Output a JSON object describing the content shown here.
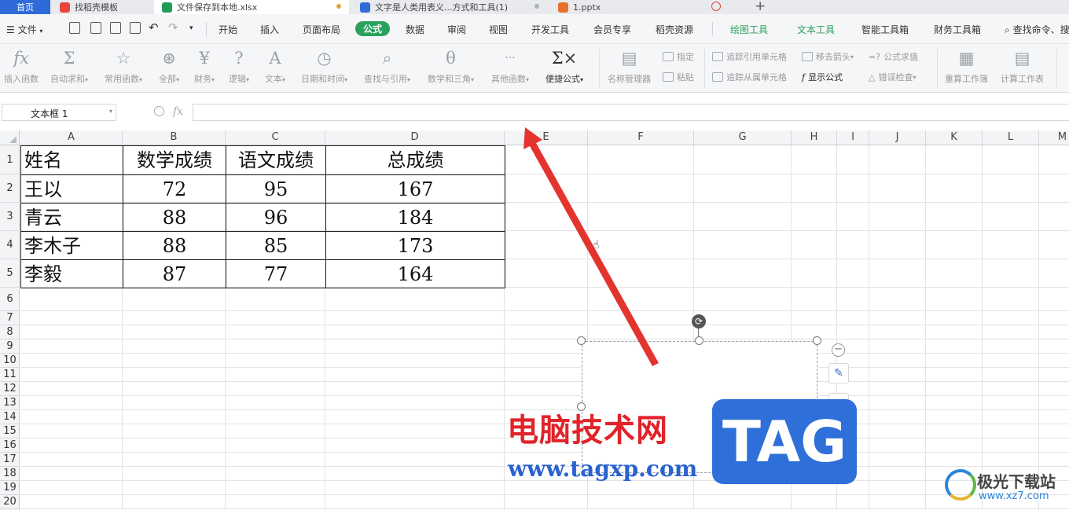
{
  "tabs": [
    {
      "label": "首页",
      "kind": "home"
    },
    {
      "label": "找稻壳模板",
      "kind": "docer",
      "color": "#e8453c"
    },
    {
      "label": "文件保存到本地.xlsx",
      "kind": "sheet",
      "color": "#1f9d55",
      "active": true,
      "dot_color": "#e6a23c"
    },
    {
      "label": "文字是人类用表义...方式和工具(1)",
      "kind": "word",
      "color": "#2f6bd8",
      "dot_color": "#b0b3b8"
    },
    {
      "label": "1.pptx",
      "kind": "ppt",
      "color": "#e6712b",
      "dot_color": "#e04b3a"
    }
  ],
  "menu": {
    "file": "文件",
    "items": [
      "开始",
      "插入",
      "页面布局",
      "公式",
      "数据",
      "审阅",
      "视图",
      "开发工具",
      "会员专享",
      "稻壳资源"
    ],
    "active": "公式",
    "green_items": [
      "绘图工具",
      "文本工具"
    ],
    "right_items": [
      "智能工具箱",
      "财务工具箱"
    ],
    "search": "查找命令、搜"
  },
  "ribbon": {
    "buttons": [
      {
        "label": "插入函数",
        "icon": "fx-icon",
        "glyph": "fx"
      },
      {
        "label": "自动求和",
        "icon": "sigma-icon",
        "glyph": "Σ",
        "caret": true
      },
      {
        "label": "常用函数",
        "icon": "star-icon",
        "glyph": "☆",
        "caret": true
      },
      {
        "label": "全部",
        "icon": "asterisk-icon",
        "glyph": "⊛",
        "caret": true
      },
      {
        "label": "财务",
        "icon": "yen-icon",
        "glyph": "¥",
        "caret": true
      },
      {
        "label": "逻辑",
        "icon": "question-icon",
        "glyph": "?",
        "caret": true
      },
      {
        "label": "文本",
        "icon": "text-a-icon",
        "glyph": "A",
        "caret": true
      },
      {
        "label": "日期和时间",
        "icon": "clock-icon",
        "glyph": "◷",
        "caret": true
      },
      {
        "label": "查找与引用",
        "icon": "search-icon",
        "glyph": "⌕",
        "caret": true
      },
      {
        "label": "数学和三角",
        "icon": "math-icon",
        "glyph": "θ",
        "caret": true
      },
      {
        "label": "其他函数",
        "icon": "more-icon",
        "glyph": "···",
        "caret": true
      },
      {
        "label": "便捷公式",
        "icon": "quick-formula-icon",
        "glyph": "Σ×",
        "caret": true,
        "dark": true
      },
      {
        "label": "名称管理器",
        "icon": "name-manager-icon",
        "glyph": "▤"
      },
      {
        "label": "重算工作簿",
        "icon": "recalc-workbook-icon",
        "glyph": "▦"
      },
      {
        "label": "计算工作表",
        "icon": "calc-sheet-icon",
        "glyph": "▤"
      }
    ],
    "small": {
      "assign": "指定",
      "paste": "粘贴",
      "trace_precedents": "追踪引用单元格",
      "trace_dependents": "追踪从属单元格",
      "remove_arrows": "移去箭头",
      "show_formula": "显示公式",
      "evaluate": "公式求值",
      "error_check": "错误检查"
    }
  },
  "formula_bar": {
    "name_box": "文本框 1",
    "fx": "fx",
    "value": ""
  },
  "columns": [
    "A",
    "B",
    "C",
    "D",
    "E",
    "F",
    "G",
    "H",
    "I",
    "J",
    "K",
    "L",
    "M"
  ],
  "rows": [
    "1",
    "2",
    "3",
    "4",
    "5",
    "6",
    "7",
    "8",
    "9",
    "10",
    "11",
    "12",
    "13",
    "14",
    "15",
    "16",
    "17",
    "18",
    "19",
    "20"
  ],
  "table": {
    "headers": [
      "姓名",
      "数学成绩",
      "语文成绩",
      "总成绩"
    ],
    "rows": [
      [
        "王以",
        "72",
        "95",
        "167"
      ],
      [
        "青云",
        "88",
        "96",
        "184"
      ],
      [
        "李木子",
        "88",
        "85",
        "173"
      ],
      [
        "李毅",
        "87",
        "77",
        "164"
      ]
    ]
  },
  "watermark": {
    "cn": "电脑技术网",
    "url": "www.tagxp.com",
    "tag": "TAG",
    "site": "极光下载站",
    "site_url": "www.xz7.com"
  },
  "colors": {
    "accent": "#2aa15c",
    "arrow": "#e3342f",
    "tab_blue": "#2f6bd8"
  }
}
